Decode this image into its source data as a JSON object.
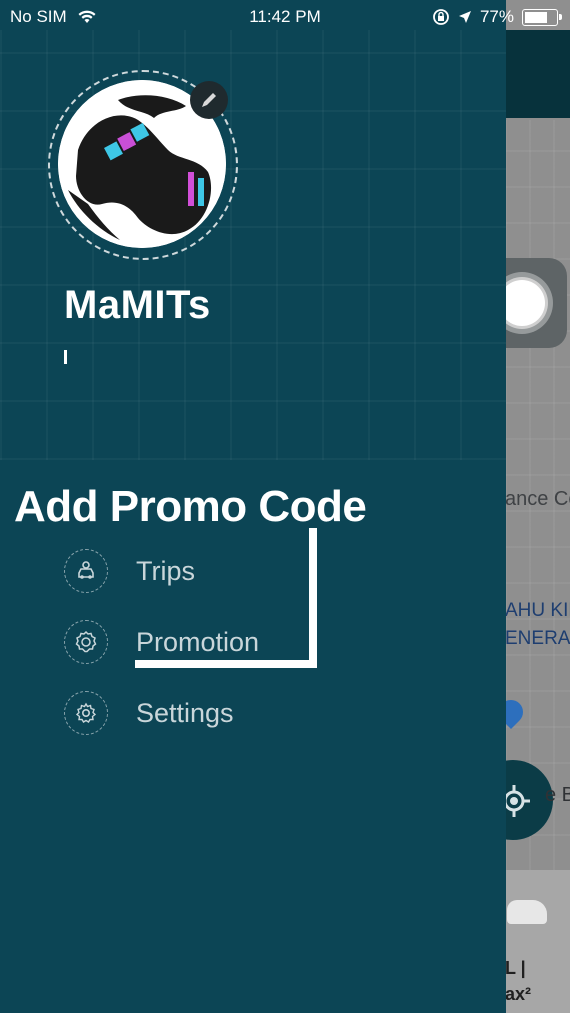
{
  "status_bar": {
    "carrier": "No SIM",
    "time": "11:42 PM",
    "battery": "77%",
    "battery_level": 0.77
  },
  "drawer": {
    "username": "MaMITs",
    "avatar_icon": "globe-logo-icon",
    "edit_icon": "pencil-icon"
  },
  "annotation": {
    "text": "Add Promo Code"
  },
  "menu": {
    "items": [
      {
        "label": "Trips",
        "icon": "car-icon"
      },
      {
        "label": "Promotion",
        "icon": "badge-icon"
      },
      {
        "label": "Settings",
        "icon": "gear-icon"
      }
    ]
  },
  "background_map": {
    "text1": "ance Co",
    "text2": "AHU KIP",
    "text3": "ENERAL",
    "text4": "e B",
    "card_line1": "L |",
    "card_line2": "ax²"
  },
  "colors": {
    "drawer_bg": "#0c4555",
    "annotation": "#ffffff",
    "menu_text": "#c9d6da"
  }
}
